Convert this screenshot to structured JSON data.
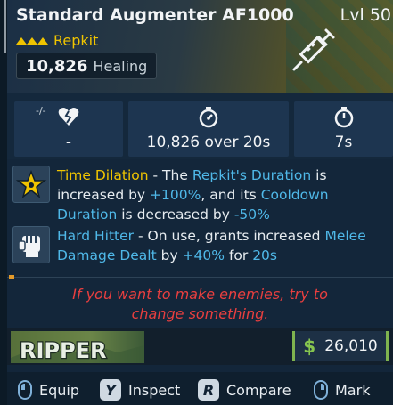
{
  "item": {
    "name": "Standard Augmenter AF1000",
    "level": "Lvl 50",
    "manufacturer": "Repkit",
    "healing_value": "10,826",
    "healing_label": "Healing"
  },
  "stats": {
    "a_na_label": "-/-",
    "a_value": "-",
    "b_value": "10,826 over 20s",
    "c_value": "7s"
  },
  "perks": [
    {
      "name": "Time Dilation",
      "text_parts": [
        " - The ",
        "Repkit's Duration",
        " is increased by ",
        "+100%",
        ", and its ",
        "Cooldown Duration",
        " is decreased by ",
        "-50%"
      ]
    },
    {
      "name": "Hard Hitter",
      "text_parts": [
        " - On use, grants increased ",
        "Melee Damage Dealt",
        " by ",
        "+40%",
        " for ",
        "20s"
      ]
    }
  ],
  "flavor": {
    "line1": "If you want to make enemies, try to",
    "line2": "change something."
  },
  "brand_logo": "RIPPER",
  "price": {
    "symbol": "$",
    "value": "26,010"
  },
  "actions": [
    {
      "key": "mouse-left",
      "label": "Equip"
    },
    {
      "key": "Y",
      "label": "Inspect"
    },
    {
      "key": "R",
      "label": "Compare"
    },
    {
      "key": "mouse-right",
      "label": "Mark"
    }
  ],
  "colors": {
    "manufacturer_yellow": "#f0c400",
    "highlight_blue": "#4fb8e8",
    "flavor_red": "#e83f3f",
    "money_green": "#86c54f"
  },
  "icons": {
    "header": "syringe-icon",
    "stat_a": "broken-heart-icon",
    "stat_b": "stopwatch-icon",
    "stat_c": "timer-icon",
    "perk1": "star-icon",
    "perk2": "fist-icon"
  }
}
